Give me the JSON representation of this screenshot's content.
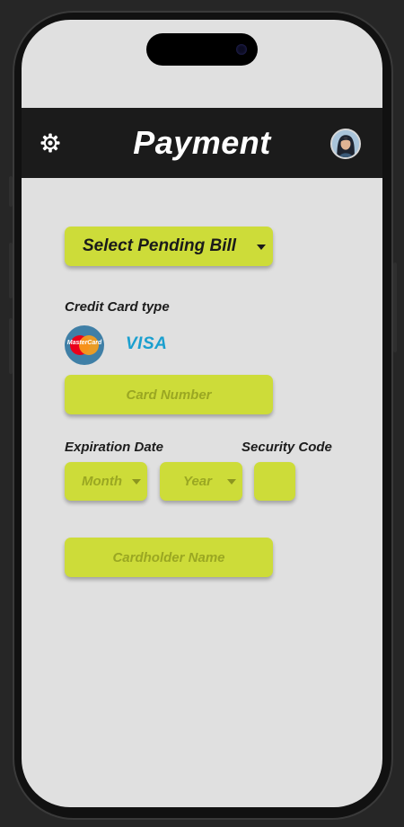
{
  "header": {
    "title": "Payment",
    "settings_icon": "gear-icon",
    "avatar_icon": "user-avatar"
  },
  "bill_select": {
    "label": "Select Pending Bill",
    "icon": "chevron-down-icon"
  },
  "card_type": {
    "label": "Credit Card type",
    "options": [
      {
        "name": "mastercard-logo",
        "text": "MasterCard"
      },
      {
        "name": "visa-logo",
        "text": "VISA"
      }
    ]
  },
  "card_number": {
    "placeholder": "Card Number"
  },
  "expiration": {
    "label": "Expiration Date",
    "month_placeholder": "Month",
    "year_placeholder": "Year"
  },
  "security": {
    "label": "Security Code"
  },
  "cardholder": {
    "placeholder": "Cardholder Name"
  },
  "colors": {
    "accent": "#cddc39",
    "header_bg": "#1b1b1b",
    "screen_bg": "#e0e0e0",
    "visa_blue": "#1a9fcf",
    "mastercard_red": "#eb001b",
    "mastercard_orange": "#f79e1b"
  }
}
